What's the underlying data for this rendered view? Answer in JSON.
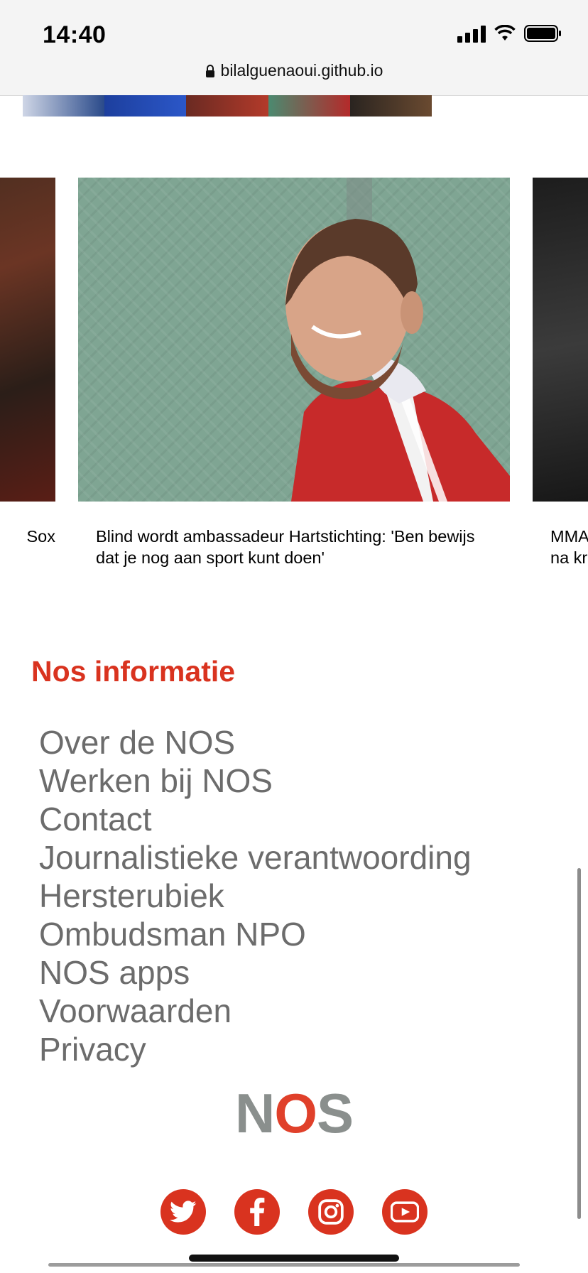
{
  "status_bar": {
    "time": "14:40"
  },
  "browser": {
    "url": "bilalguenaoui.github.io"
  },
  "carousel": {
    "left_caption": "Sox",
    "center_caption": "Blind wordt ambassadeur Hartstichting: 'Ben bewijs dat je nog aan sport kunt doen'",
    "right_caption_line1": "MMA",
    "right_caption_line2": "na kr"
  },
  "footer": {
    "section_title": "Nos informatie",
    "links": [
      "Over de NOS",
      "Werken bij NOS",
      "Contact",
      "Journalistieke verantwoording",
      "Hersterubiek",
      "Ombudsman NPO",
      "NOS apps",
      "Voorwaarden",
      "Privacy"
    ],
    "logo": {
      "n": "N",
      "o": "O",
      "s": "S"
    }
  },
  "social": [
    {
      "icon": "twitter-icon"
    },
    {
      "icon": "facebook-icon"
    },
    {
      "icon": "instagram-icon"
    },
    {
      "icon": "youtube-icon"
    }
  ],
  "colors": {
    "accent": "#d9331f",
    "link_gray": "#6c6c6c",
    "logo_gray": "#8a8f8d"
  }
}
